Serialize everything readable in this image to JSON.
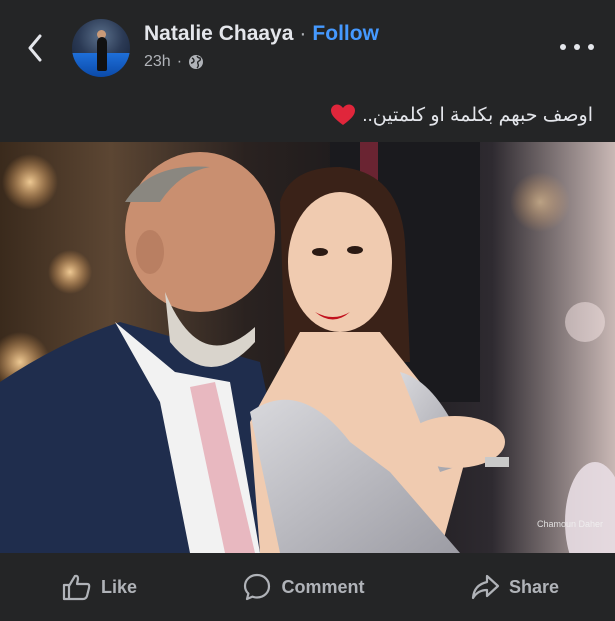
{
  "post": {
    "author_name": "Natalie Chaaya",
    "separator": "·",
    "follow_label": "Follow",
    "timestamp": "23h",
    "meta_separator": "·",
    "privacy_icon": "globe-icon",
    "caption": "اوصف حبهم بكلمة او كلمتين..",
    "caption_emoji": "red-heart"
  },
  "photo": {
    "watermark": "Chamoun Daher"
  },
  "actions": {
    "like_label": "Like",
    "comment_label": "Comment",
    "share_label": "Share"
  },
  "colors": {
    "background": "#242526",
    "text_primary": "#e4e6eb",
    "text_secondary": "#b0b3b8",
    "follow_accent": "#4599ff",
    "heart": "#e0263b"
  }
}
